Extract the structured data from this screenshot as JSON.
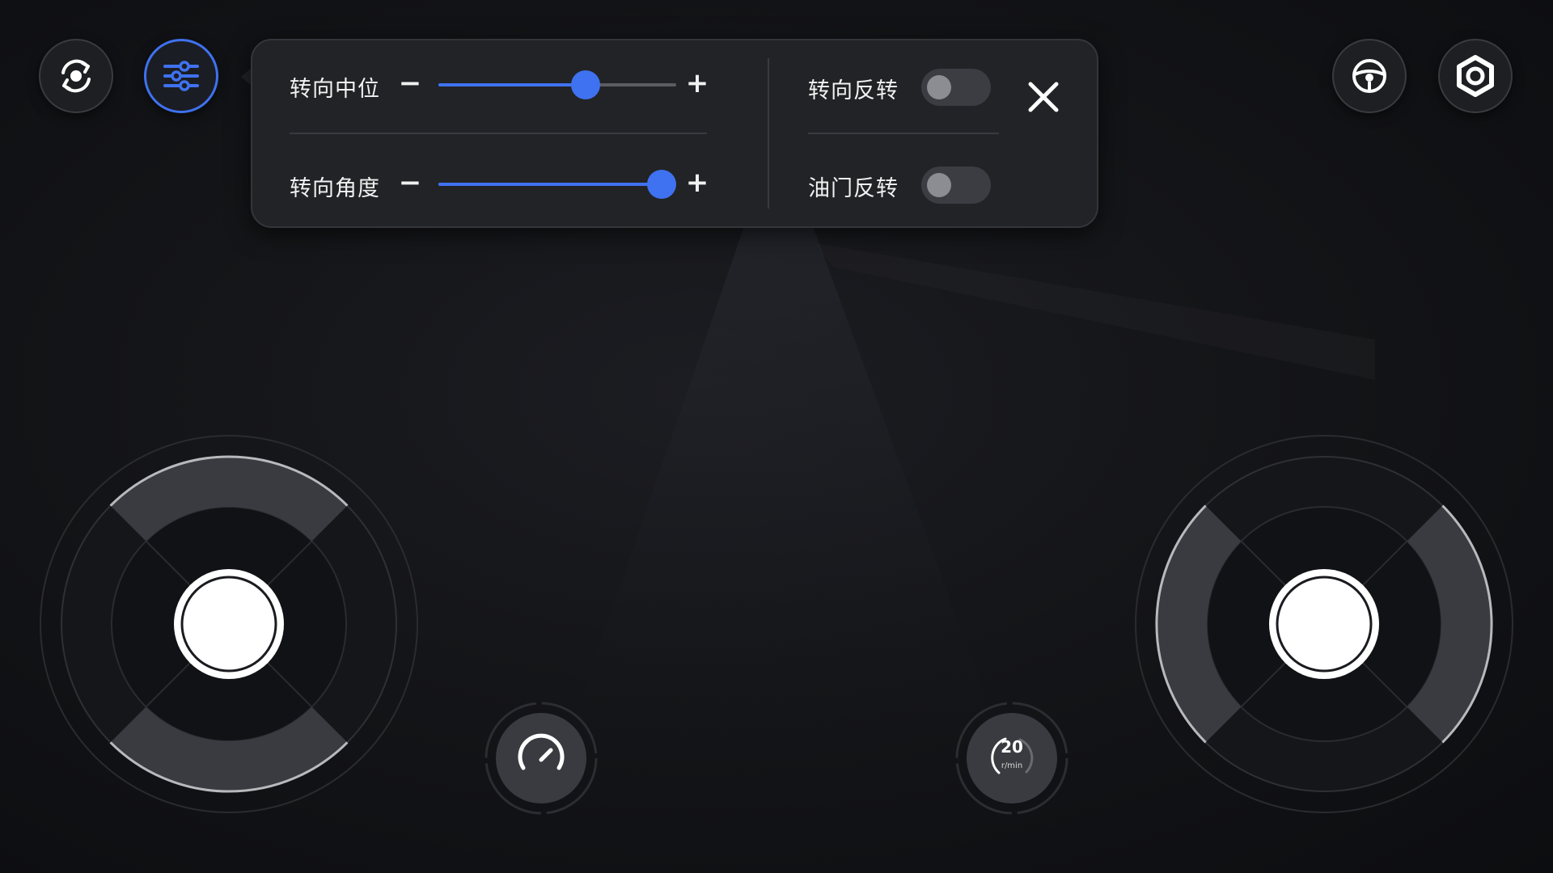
{
  "settings_panel": {
    "steering_center": {
      "label": "转向中位",
      "minus": "−",
      "plus": "+",
      "value_fraction": 0.62
    },
    "steering_angle": {
      "label": "转向角度",
      "minus": "−",
      "plus": "+",
      "value_fraction": 0.94
    },
    "steering_reverse": {
      "label": "转向反转",
      "on": false
    },
    "throttle_reverse": {
      "label": "油门反转",
      "on": false
    }
  },
  "top_left_buttons": [
    "rotate-camera-icon",
    "sliders-icon"
  ],
  "top_right_buttons": [
    "steering-wheel-icon",
    "gear-icon"
  ],
  "gauges": {
    "speed": {
      "icon": "speedometer-icon"
    },
    "rpm": {
      "value": "20",
      "unit": "r/min"
    }
  },
  "colors": {
    "accent": "#3f72f0",
    "background": "#141518",
    "panel": "#222327"
  }
}
